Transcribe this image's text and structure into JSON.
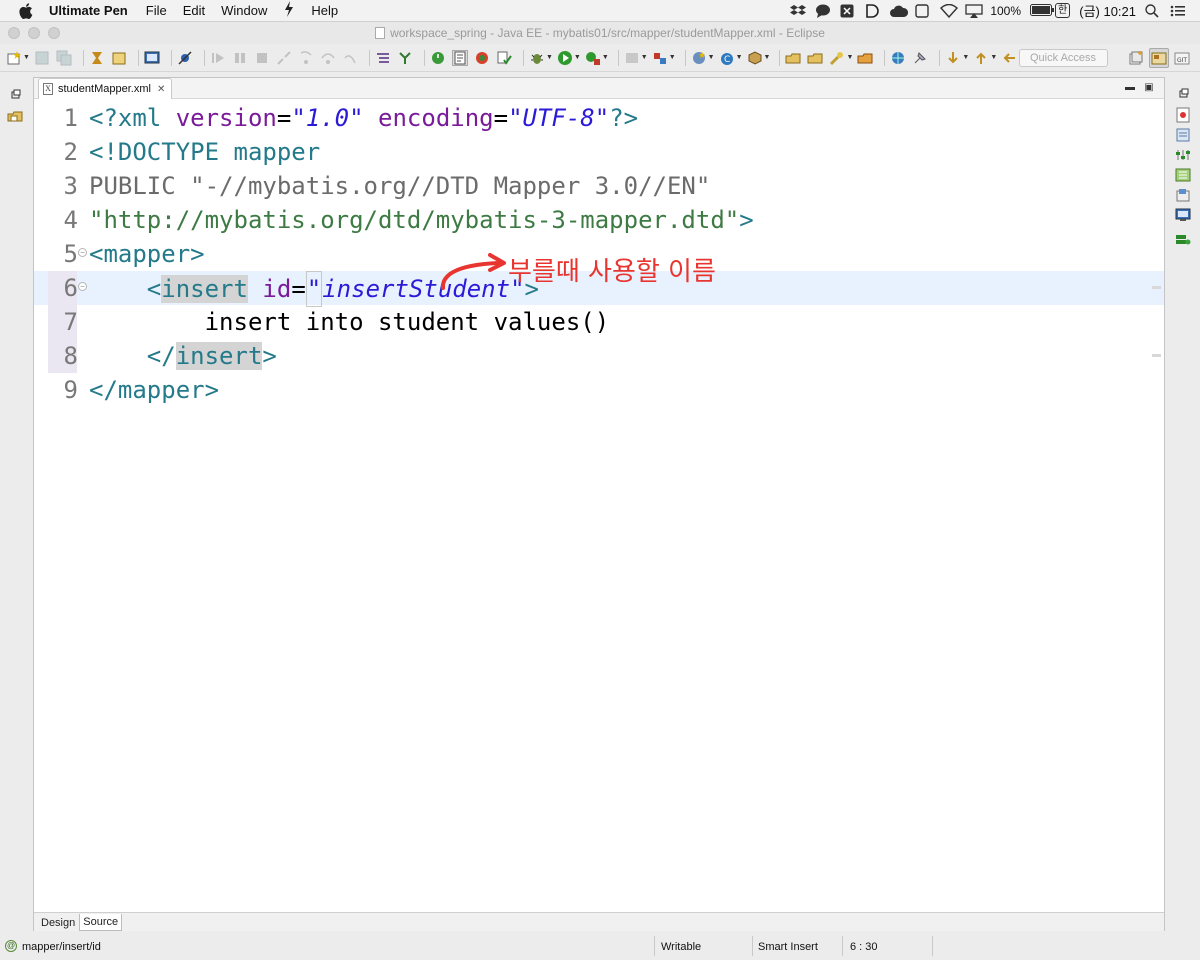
{
  "menubar": {
    "app_name": "Ultimate Pen",
    "items": [
      "File",
      "Edit",
      "Window",
      "Help"
    ],
    "battery": "100%",
    "ime": "한",
    "clock": "(금) 10:21"
  },
  "window": {
    "title": "workspace_spring - Java EE - mybatis01/src/mapper/studentMapper.xml - Eclipse"
  },
  "toolbar": {
    "quick_access_placeholder": "Quick Access"
  },
  "editor": {
    "tab_label": "studentMapper.xml",
    "lines": [
      {
        "num": "1",
        "open": "<?xml ",
        "attr1": "version",
        "eq1": "=",
        "val1": "\"1.0\"",
        "sp": " ",
        "attr2": "encoding",
        "eq2": "=",
        "val2": "\"UTF-8\"",
        "close": "?>"
      },
      {
        "num": "2",
        "text": "<!DOCTYPE mapper"
      },
      {
        "num": "3",
        "text": "PUBLIC \"-//mybatis.org//DTD Mapper 3.0//EN\""
      },
      {
        "num": "4",
        "str": "\"http://mybatis.org/dtd/mybatis-3-mapper.dtd\"",
        "close": ">"
      },
      {
        "num": "5",
        "tag": "<mapper>"
      },
      {
        "num": "6",
        "indent": "    ",
        "lt": "<",
        "tag": "insert",
        "sp": " ",
        "attr": "id",
        "eq": "=",
        "q1": "\"",
        "val": "insertStudent",
        "q2": "\"",
        "gt": ">"
      },
      {
        "num": "7",
        "text": "        insert into student values()"
      },
      {
        "num": "8",
        "indent": "    ",
        "lt": "</",
        "tag": "insert",
        "gt": ">"
      },
      {
        "num": "9",
        "tag": "</mapper>"
      }
    ],
    "page_tabs": [
      "Design",
      "Source"
    ],
    "active_page_tab": "Source"
  },
  "annotation": {
    "text": "부를때 사용할 이름",
    "color": "#e8352f"
  },
  "statusbar": {
    "path": "mapper/insert/id",
    "mode": "Writable",
    "insert_mode": "Smart Insert",
    "position": "6 : 30"
  }
}
